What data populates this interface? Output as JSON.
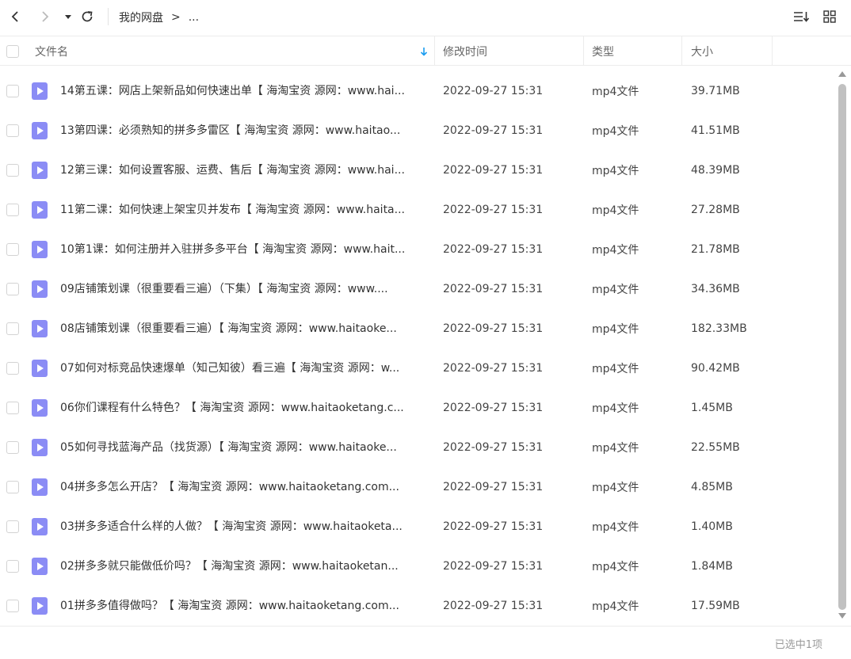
{
  "toolbar": {
    "breadcrumb_root": "我的网盘",
    "breadcrumb_sep": ">",
    "breadcrumb_more": "..."
  },
  "columns": {
    "name": "文件名",
    "modified": "修改时间",
    "type": "类型",
    "size": "大小"
  },
  "files": [
    {
      "name": "14第五课：网店上架新品如何快速出单【 海淘宝资 源网：www.hai...",
      "time": "2022-09-27 15:31",
      "type": "mp4文件",
      "size": "39.71MB"
    },
    {
      "name": "13第四课：必须熟知的拼多多雷区【 海淘宝资 源网：www.haitao...",
      "time": "2022-09-27 15:31",
      "type": "mp4文件",
      "size": "41.51MB"
    },
    {
      "name": "12第三课：如何设置客服、运费、售后【 海淘宝资 源网：www.hai...",
      "time": "2022-09-27 15:31",
      "type": "mp4文件",
      "size": "48.39MB"
    },
    {
      "name": "11第二课：如何快速上架宝贝并发布【 海淘宝资 源网：www.haita...",
      "time": "2022-09-27 15:31",
      "type": "mp4文件",
      "size": "27.28MB"
    },
    {
      "name": "10第1课：如何注册并入驻拼多多平台【 海淘宝资 源网：www.hait...",
      "time": "2022-09-27 15:31",
      "type": "mp4文件",
      "size": "21.78MB"
    },
    {
      "name": "09店铺策划课（很重要看三遍）（下集）【 海淘宝资 源网：www....",
      "time": "2022-09-27 15:31",
      "type": "mp4文件",
      "size": "34.36MB"
    },
    {
      "name": "08店铺策划课（很重要看三遍）【 海淘宝资 源网：www.haitaoke...",
      "time": "2022-09-27 15:31",
      "type": "mp4文件",
      "size": "182.33MB"
    },
    {
      "name": "07如何对标竞品快速爆单（知己知彼）看三遍【 海淘宝资 源网：w...",
      "time": "2022-09-27 15:31",
      "type": "mp4文件",
      "size": "90.42MB"
    },
    {
      "name": "06你们课程有什么特色？【 海淘宝资 源网：www.haitaoketang.c...",
      "time": "2022-09-27 15:31",
      "type": "mp4文件",
      "size": "1.45MB"
    },
    {
      "name": "05如何寻找蓝海产品（找货源）【 海淘宝资 源网：www.haitaoke...",
      "time": "2022-09-27 15:31",
      "type": "mp4文件",
      "size": "22.55MB"
    },
    {
      "name": "04拼多多怎么开店？【 海淘宝资 源网：www.haitaoketang.com...",
      "time": "2022-09-27 15:31",
      "type": "mp4文件",
      "size": "4.85MB"
    },
    {
      "name": "03拼多多适合什么样的人做？【 海淘宝资 源网：www.haitaoketa...",
      "time": "2022-09-27 15:31",
      "type": "mp4文件",
      "size": "1.40MB"
    },
    {
      "name": "02拼多多就只能做低价吗？【 海淘宝资 源网：www.haitaoketan...",
      "time": "2022-09-27 15:31",
      "type": "mp4文件",
      "size": "1.84MB"
    },
    {
      "name": "01拼多多值得做吗？【 海淘宝资 源网：www.haitaoketang.com...",
      "time": "2022-09-27 15:31",
      "type": "mp4文件",
      "size": "17.59MB"
    }
  ],
  "footer": {
    "selection_status": "已选中1项"
  },
  "colors": {
    "file_icon": "#8b8cf5",
    "sort_arrow": "#1a9cf0"
  },
  "icons": [
    "back-icon",
    "forward-icon",
    "dropdown-icon",
    "refresh-icon",
    "sort-icon",
    "grid-view-icon",
    "sort-arrow-icon",
    "video-file-icon"
  ]
}
